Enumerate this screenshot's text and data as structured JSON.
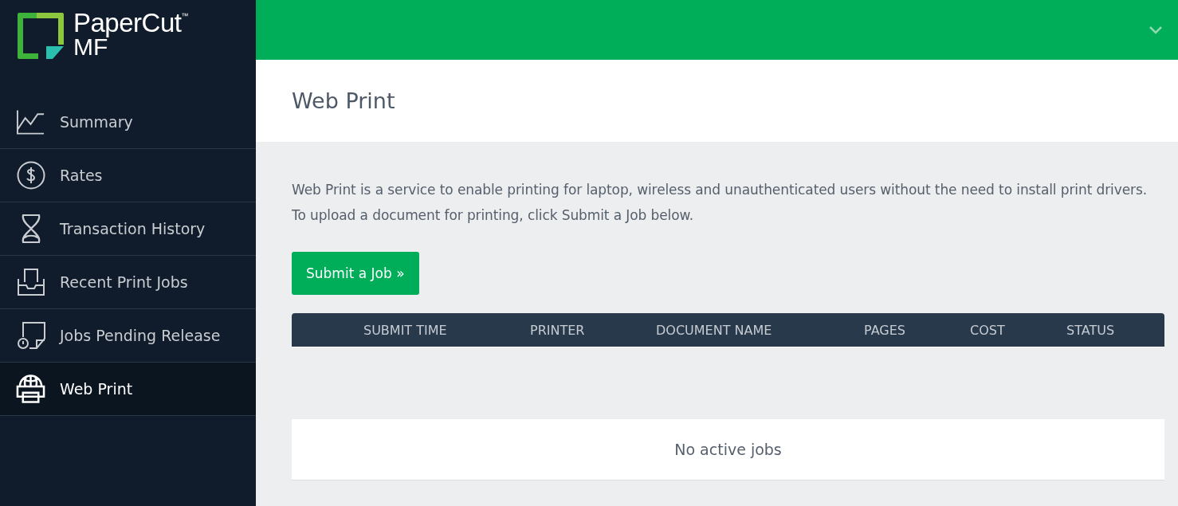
{
  "logo": {
    "name": "PaperCut",
    "trademark": "™",
    "product": "MF"
  },
  "sidebar": {
    "items": [
      {
        "label": "Summary",
        "selected": false
      },
      {
        "label": "Rates",
        "selected": false
      },
      {
        "label": "Transaction History",
        "selected": false
      },
      {
        "label": "Recent Print Jobs",
        "selected": false
      },
      {
        "label": "Jobs Pending Release",
        "selected": false
      },
      {
        "label": "Web Print",
        "selected": true
      }
    ]
  },
  "page": {
    "title": "Web Print",
    "intro": "Web Print is a service to enable printing for laptop, wireless and unauthenticated users without the need to install print drivers. To upload a document for printing, click Submit a Job below.",
    "submit_button": "Submit a Job »"
  },
  "table": {
    "columns": [
      "SUBMIT TIME",
      "PRINTER",
      "DOCUMENT NAME",
      "PAGES",
      "COST",
      "STATUS"
    ],
    "empty_message": "No active jobs"
  }
}
